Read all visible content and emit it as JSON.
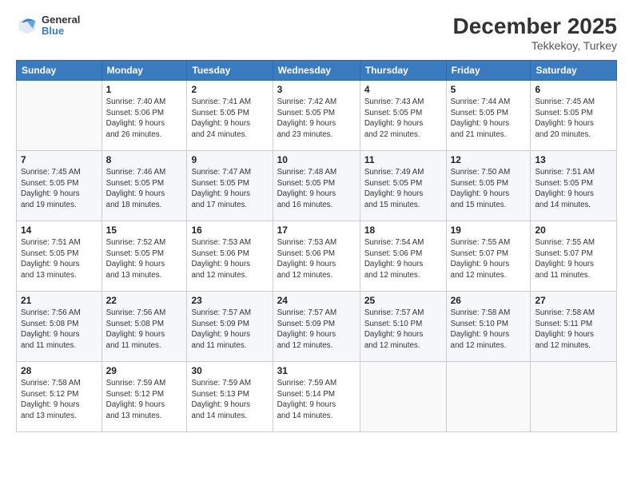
{
  "header": {
    "logo_line1": "General",
    "logo_line2": "Blue",
    "month_title": "December 2025",
    "subtitle": "Tekkekoy, Turkey"
  },
  "weekdays": [
    "Sunday",
    "Monday",
    "Tuesday",
    "Wednesday",
    "Thursday",
    "Friday",
    "Saturday"
  ],
  "weeks": [
    [
      {
        "day": "",
        "info": ""
      },
      {
        "day": "1",
        "info": "Sunrise: 7:40 AM\nSunset: 5:06 PM\nDaylight: 9 hours\nand 26 minutes."
      },
      {
        "day": "2",
        "info": "Sunrise: 7:41 AM\nSunset: 5:05 PM\nDaylight: 9 hours\nand 24 minutes."
      },
      {
        "day": "3",
        "info": "Sunrise: 7:42 AM\nSunset: 5:05 PM\nDaylight: 9 hours\nand 23 minutes."
      },
      {
        "day": "4",
        "info": "Sunrise: 7:43 AM\nSunset: 5:05 PM\nDaylight: 9 hours\nand 22 minutes."
      },
      {
        "day": "5",
        "info": "Sunrise: 7:44 AM\nSunset: 5:05 PM\nDaylight: 9 hours\nand 21 minutes."
      },
      {
        "day": "6",
        "info": "Sunrise: 7:45 AM\nSunset: 5:05 PM\nDaylight: 9 hours\nand 20 minutes."
      }
    ],
    [
      {
        "day": "7",
        "info": "Sunrise: 7:45 AM\nSunset: 5:05 PM\nDaylight: 9 hours\nand 19 minutes."
      },
      {
        "day": "8",
        "info": "Sunrise: 7:46 AM\nSunset: 5:05 PM\nDaylight: 9 hours\nand 18 minutes."
      },
      {
        "day": "9",
        "info": "Sunrise: 7:47 AM\nSunset: 5:05 PM\nDaylight: 9 hours\nand 17 minutes."
      },
      {
        "day": "10",
        "info": "Sunrise: 7:48 AM\nSunset: 5:05 PM\nDaylight: 9 hours\nand 16 minutes."
      },
      {
        "day": "11",
        "info": "Sunrise: 7:49 AM\nSunset: 5:05 PM\nDaylight: 9 hours\nand 15 minutes."
      },
      {
        "day": "12",
        "info": "Sunrise: 7:50 AM\nSunset: 5:05 PM\nDaylight: 9 hours\nand 15 minutes."
      },
      {
        "day": "13",
        "info": "Sunrise: 7:51 AM\nSunset: 5:05 PM\nDaylight: 9 hours\nand 14 minutes."
      }
    ],
    [
      {
        "day": "14",
        "info": "Sunrise: 7:51 AM\nSunset: 5:05 PM\nDaylight: 9 hours\nand 13 minutes."
      },
      {
        "day": "15",
        "info": "Sunrise: 7:52 AM\nSunset: 5:05 PM\nDaylight: 9 hours\nand 13 minutes."
      },
      {
        "day": "16",
        "info": "Sunrise: 7:53 AM\nSunset: 5:06 PM\nDaylight: 9 hours\nand 12 minutes."
      },
      {
        "day": "17",
        "info": "Sunrise: 7:53 AM\nSunset: 5:06 PM\nDaylight: 9 hours\nand 12 minutes."
      },
      {
        "day": "18",
        "info": "Sunrise: 7:54 AM\nSunset: 5:06 PM\nDaylight: 9 hours\nand 12 minutes."
      },
      {
        "day": "19",
        "info": "Sunrise: 7:55 AM\nSunset: 5:07 PM\nDaylight: 9 hours\nand 12 minutes."
      },
      {
        "day": "20",
        "info": "Sunrise: 7:55 AM\nSunset: 5:07 PM\nDaylight: 9 hours\nand 11 minutes."
      }
    ],
    [
      {
        "day": "21",
        "info": "Sunrise: 7:56 AM\nSunset: 5:08 PM\nDaylight: 9 hours\nand 11 minutes."
      },
      {
        "day": "22",
        "info": "Sunrise: 7:56 AM\nSunset: 5:08 PM\nDaylight: 9 hours\nand 11 minutes."
      },
      {
        "day": "23",
        "info": "Sunrise: 7:57 AM\nSunset: 5:09 PM\nDaylight: 9 hours\nand 11 minutes."
      },
      {
        "day": "24",
        "info": "Sunrise: 7:57 AM\nSunset: 5:09 PM\nDaylight: 9 hours\nand 12 minutes."
      },
      {
        "day": "25",
        "info": "Sunrise: 7:57 AM\nSunset: 5:10 PM\nDaylight: 9 hours\nand 12 minutes."
      },
      {
        "day": "26",
        "info": "Sunrise: 7:58 AM\nSunset: 5:10 PM\nDaylight: 9 hours\nand 12 minutes."
      },
      {
        "day": "27",
        "info": "Sunrise: 7:58 AM\nSunset: 5:11 PM\nDaylight: 9 hours\nand 12 minutes."
      }
    ],
    [
      {
        "day": "28",
        "info": "Sunrise: 7:58 AM\nSunset: 5:12 PM\nDaylight: 9 hours\nand 13 minutes."
      },
      {
        "day": "29",
        "info": "Sunrise: 7:59 AM\nSunset: 5:12 PM\nDaylight: 9 hours\nand 13 minutes."
      },
      {
        "day": "30",
        "info": "Sunrise: 7:59 AM\nSunset: 5:13 PM\nDaylight: 9 hours\nand 14 minutes."
      },
      {
        "day": "31",
        "info": "Sunrise: 7:59 AM\nSunset: 5:14 PM\nDaylight: 9 hours\nand 14 minutes."
      },
      {
        "day": "",
        "info": ""
      },
      {
        "day": "",
        "info": ""
      },
      {
        "day": "",
        "info": ""
      }
    ]
  ]
}
